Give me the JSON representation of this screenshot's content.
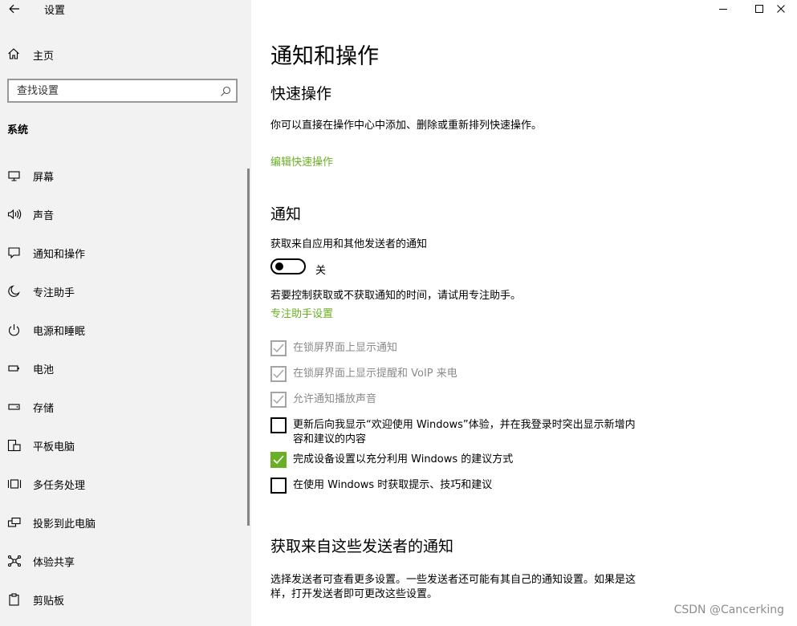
{
  "app": {
    "title": "设置"
  },
  "sidebar": {
    "home_label": "主页",
    "search_placeholder": "查找设置",
    "section": "系统",
    "items": [
      {
        "label": "屏幕",
        "icon": "monitor-icon"
      },
      {
        "label": "声音",
        "icon": "speaker-icon"
      },
      {
        "label": "通知和操作",
        "icon": "notification-icon"
      },
      {
        "label": "专注助手",
        "icon": "moon-icon"
      },
      {
        "label": "电源和睡眠",
        "icon": "power-icon"
      },
      {
        "label": "电池",
        "icon": "battery-icon"
      },
      {
        "label": "存储",
        "icon": "storage-icon"
      },
      {
        "label": "平板电脑",
        "icon": "tablet-icon"
      },
      {
        "label": "多任务处理",
        "icon": "multitask-icon"
      },
      {
        "label": "投影到此电脑",
        "icon": "project-icon"
      },
      {
        "label": "体验共享",
        "icon": "share-icon"
      },
      {
        "label": "剪贴板",
        "icon": "clipboard-icon"
      }
    ]
  },
  "main": {
    "title": "通知和操作",
    "quick": {
      "heading": "快速操作",
      "desc": "你可以直接在操作中心中添加、删除或重新排列快速操作。",
      "link": "编辑快速操作"
    },
    "notify": {
      "heading": "通知",
      "toggle_caption": "获取来自应用和其他发送者的通知",
      "toggle_state": "关",
      "hint": "若要控制获取或不获取通知的时间，请试用专注助手。",
      "link": "专注助手设置",
      "checkboxes": [
        {
          "label": "在锁屏界面上显示通知",
          "checked": true,
          "disabled": true
        },
        {
          "label": "在锁屏界面上显示提醒和 VoIP 来电",
          "checked": true,
          "disabled": true
        },
        {
          "label": "允许通知播放声音",
          "checked": true,
          "disabled": true
        },
        {
          "label": "更新后向我显示“欢迎使用 Windows”体验，并在我登录时突出显示新增内容和建议的内容",
          "checked": false,
          "disabled": false
        },
        {
          "label": "完成设备设置以充分利用 Windows 的建议方式",
          "checked": true,
          "disabled": false
        },
        {
          "label": "在使用 Windows 时获取提示、技巧和建议",
          "checked": false,
          "disabled": false
        }
      ]
    },
    "senders": {
      "heading": "获取来自这些发送者的通知",
      "desc": "选择发送者可查看更多设置。一些发送者还可能有其自己的通知设置。如果是这样，打开发送者即可更改这些设置。"
    }
  },
  "watermark": "CSDN @Cancerking",
  "colors": {
    "accent": "#6ab024",
    "sidebar_bg": "#f2f2f2",
    "disabled_text": "#8a8a8a"
  }
}
